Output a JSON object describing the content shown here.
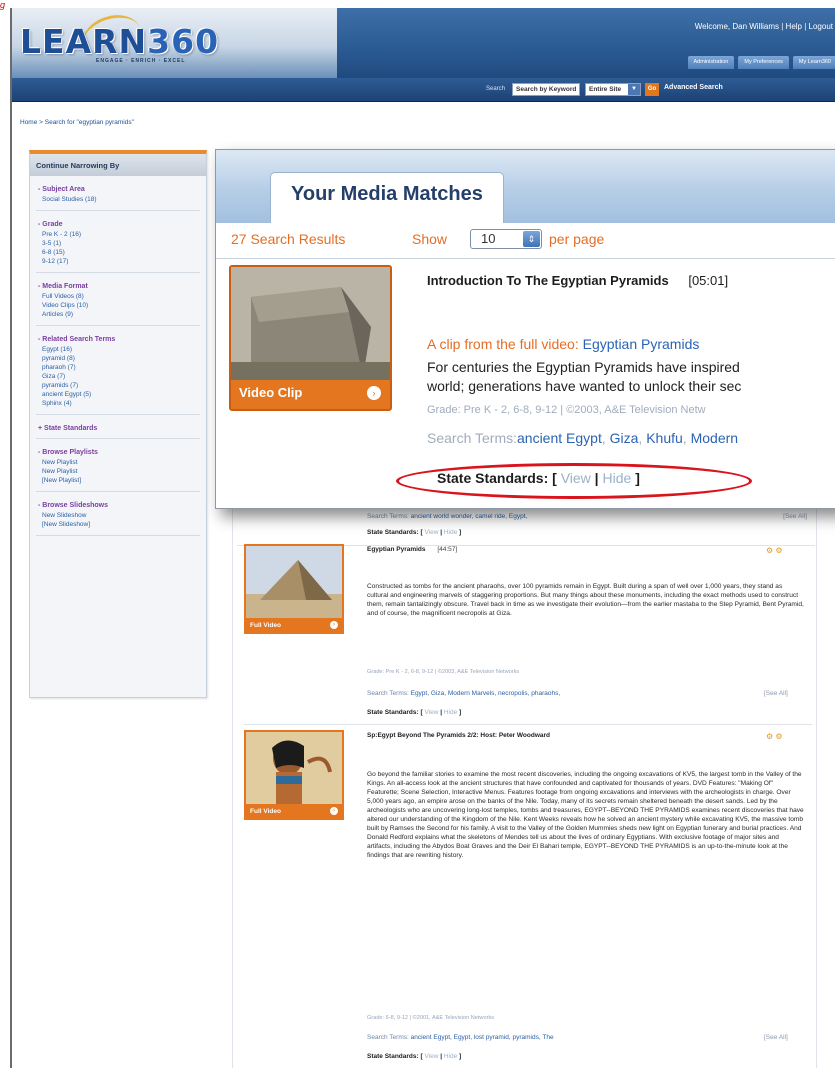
{
  "figure_label": "g",
  "header": {
    "logo_text": "LEARN",
    "logo_num": "360",
    "tagline": "ENGAGE · ENRICH · EXCEL",
    "welcome": "Welcome, Dan Williams",
    "help": "Help",
    "logout": "Logout",
    "nav": [
      "Administration",
      "My Preferences",
      "My Learn360"
    ]
  },
  "search": {
    "label": "Search",
    "keyword_value": "Search by Keyword",
    "scope_value": "Entire Site",
    "go_label": "Go",
    "advanced_label": "Advanced Search"
  },
  "breadcrumb": "Home > Search for \"egyptian pyramids\"",
  "sidebar": {
    "title": "Continue Narrowing By",
    "sections": [
      {
        "head": "- Subject Area",
        "items": [
          "Social Studies (18)"
        ]
      },
      {
        "head": "- Grade",
        "items": [
          "Pre K - 2 (16)",
          "3-5 (1)",
          "6-8 (15)",
          "9-12 (17)"
        ]
      },
      {
        "head": "- Media Format",
        "items": [
          "Full Videos (8)",
          "Video Clips (10)",
          "Articles (9)"
        ]
      },
      {
        "head": "- Related Search Terms",
        "items": [
          "Egypt (16)",
          "pyramid (8)",
          "pharaoh (7)",
          "Giza (7)",
          "pyramids (7)",
          "ancient Egypt (5)",
          "Sphinx (4)"
        ]
      },
      {
        "head": "+ State Standards",
        "items": []
      },
      {
        "head": "- Browse Playlists",
        "items": [
          "New Playlist",
          "New Playlist",
          "[New Playlist]"
        ]
      },
      {
        "head": "- Browse Slideshows",
        "items": [
          "New Slideshow",
          "[New Slideshow]"
        ]
      }
    ]
  },
  "zoom": {
    "tab_title": "Your Media Matches",
    "results_count": "27 Search Results",
    "show_label": "Show",
    "per_page_value": "10",
    "per_page_label": "per page",
    "item_title": "Introduction To The Egyptian Pyramids",
    "item_duration": "[05:01]",
    "clip_prefix": "A clip from the full video: ",
    "clip_link": "Egyptian Pyramids",
    "desc_line1": "For centuries the Egyptian Pyramids have inspired",
    "desc_line2": "world; generations have wanted to unlock their sec",
    "meta": "Grade: Pre K - 2, 6-8, 9-12 | ©2003, A&E Television Netw",
    "terms_label": "Search Terms:",
    "terms": [
      "ancient Egypt",
      "Giza",
      "Khufu",
      "Modern"
    ],
    "thumb_label": "Video Clip",
    "std_label": "State Standards: [",
    "std_view": "View",
    "std_hide": "Hide",
    "std_close": "]"
  },
  "ghost_row": {
    "terms_label": "Search Terms:",
    "terms": "ancient world wonder, camel ride, Egypt,",
    "see_all": "[See All]",
    "std_label": "State Standards: [",
    "std_view": "View",
    "std_hide": "Hide",
    "std_close": "]"
  },
  "items": [
    {
      "title": "Egyptian Pyramids",
      "duration": "[44:57]",
      "thumb_label": "Full Video",
      "desc": "Constructed as tombs for the ancient pharaohs, over 100 pyramids remain in Egypt. Built during a span of well over 1,000 years, they stand as cultural and engineering marvels of staggering proportions. But many things about these monuments, including the exact methods used to construct them, remain tantalizingly obscure. Travel back in time as we investigate their evolution—from the earlier mastaba to the Step Pyramid, Bent Pyramid, and of course, the magnificent necropolis at Giza.",
      "meta": "Grade: Pre K - 2, 6-8, 9-12 | ©2003, A&E Television Networks",
      "terms_label": "Search Terms:",
      "terms": "Egypt, Giza, Modern Marvels, necropolis, pharaohs,",
      "see_all": "[See All]",
      "std_label": "State Standards: [",
      "std_view": "View",
      "std_hide": "Hide",
      "std_close": "]"
    },
    {
      "title": "Sp:Egypt Beyond The Pyramids 2/2: Host: Peter Woodward",
      "duration": "",
      "thumb_label": "Full Video",
      "desc": "Go beyond the familiar stories to examine the most recent discoveries, including the ongoing excavations of KV5, the largest tomb in the Valley of the Kings. An all-access look at the ancient structures that have confounded and captivated for thousands of years. DVD Features: \"Making Of\" Featurette; Scene Selection, Interactive Menus. Features footage from ongoing excavations and interviews with the archeologists in charge. Over 5,000 years ago, an empire arose on the banks of the Nile. Today, many of its secrets remain sheltered beneath the desert sands. Led by the archeologists who are uncovering long-lost temples, tombs and treasures, EGYPT--BEYOND THE PYRAMIDS examines recent discoveries that have altered our understanding of the Kingdom of the Nile. Kent Weeks reveals how he solved an ancient mystery while excavating KV5, the massive tomb built by Ramses the Second for his family. A visit to the Valley of the Golden Mummies sheds new light on Egyptian funerary and burial practices. And Donald Redford explains what the skeletons of Mendes tell us about the lives of ordinary Egyptians. With exclusive footage of major sites and artifacts, including the Abydos Boat Graves and the Deir El Bahari temple, EGYPT--BEYOND THE PYRAMIDS is an up-to-the-minute look at the findings that are rewriting history.",
      "meta": "Grade: 6-8, 9-12 | ©2001, A&E Television Networks",
      "terms_label": "Search Terms:",
      "terms": "ancient Egypt, Egypt, lost pyramid, pyramids, The",
      "see_all": "[See All]",
      "std_label": "State Standards: [",
      "std_view": "View",
      "std_hide": "Hide",
      "std_close": "]"
    }
  ],
  "colors": {
    "accent_orange": "#e36e25",
    "link_blue": "#2a63b5",
    "header_blue": "#1f4a7f",
    "sidebar_head_purple": "#7a3fa0",
    "highlight_red": "#d9141c"
  }
}
